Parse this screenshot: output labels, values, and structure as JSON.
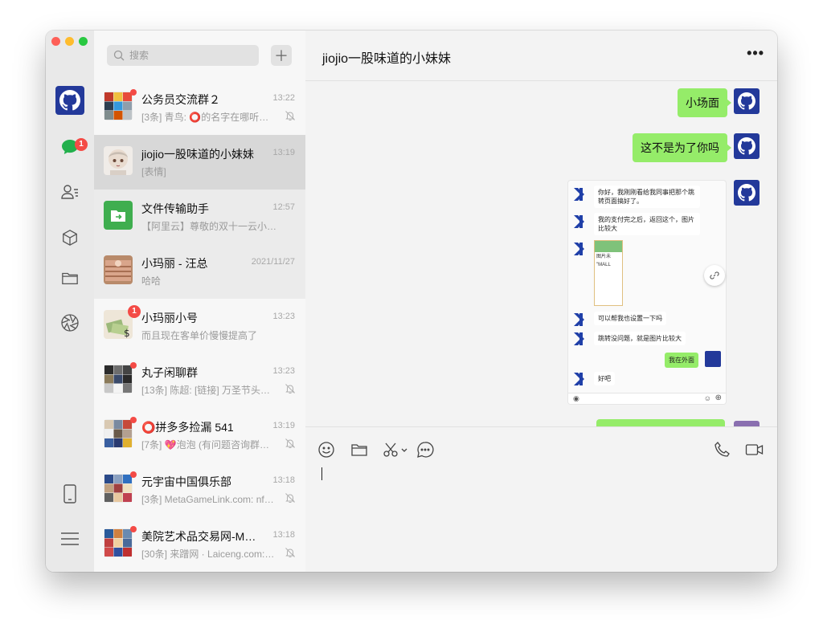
{
  "search": {
    "placeholder": "搜索"
  },
  "rail": {
    "chat_badge": "1"
  },
  "conversations": [
    {
      "name": "公务员交流群２",
      "time": "13:22",
      "preview": "[3条] 青鸟: ⭕的名字在哪听…",
      "muted": true,
      "dot": true
    },
    {
      "name": "jiojio一股味道的小妹妹",
      "time": "13:19",
      "preview": "[表情]",
      "selected": true
    },
    {
      "name": "文件传输助手",
      "time": "12:57",
      "preview": "【阿里云】尊敬的双十一云小宝…",
      "pinned": true
    },
    {
      "name": "小玛丽 - 汪总",
      "time": "2021/11/27",
      "preview": "哈哈",
      "pinned": true
    },
    {
      "name": "小玛丽小号",
      "time": "13:23",
      "preview": "而且现在客单价慢慢提高了",
      "badge": "1"
    },
    {
      "name": "丸子闲聊群",
      "time": "13:23",
      "preview": "[13条] 陈超: [链接] 万圣节头…",
      "muted": true,
      "dot": true
    },
    {
      "name": "⭕拼多多捡漏 541",
      "time": "13:19",
      "preview": "[7条] 💖泡泡 (有问题咨询群…",
      "muted": true,
      "dot": true
    },
    {
      "name": "元宇宙中国俱乐部",
      "time": "13:18",
      "preview": "[3条] MetaGameLink.com: nf…",
      "muted": true,
      "dot": true
    },
    {
      "name": "美院艺术品交易网-Me…",
      "time": "13:18",
      "preview": "[30条] 来蹭网 · Laiceng.com:…",
      "muted": true,
      "dot": true
    }
  ],
  "chat": {
    "title": "jiojio一股味道的小妹妹",
    "messages": [
      "小场面",
      "这不是为了你吗"
    ],
    "screenshot": {
      "m1": "你好，我刚刚看给我同事把那个跳转页面搞好了。",
      "m2": "我的支付完之后，返回这个，图片比较大",
      "m3": "可以帮我也设置一下吗",
      "m4": "跳转没问题，就是图片比较大",
      "m5": "我在外面",
      "m6": "好吧",
      "thumb_l1": "图片未",
      "thumb_l2": "\"MALL"
    }
  },
  "colors": {
    "accent_green": "#95ec69",
    "badge_red": "#f44b46",
    "avatar_blue": "#23399a"
  }
}
